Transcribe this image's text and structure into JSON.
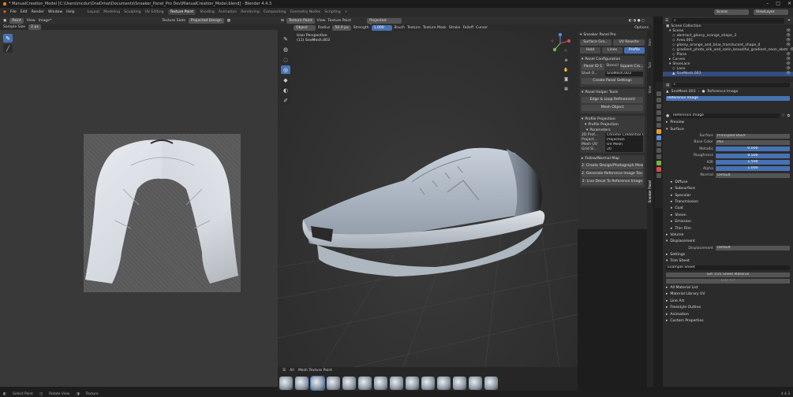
{
  "app": {
    "title": "* ManualCreation_Model [C:\\Users\\mcdur\\OneDrive\\Documents\\Sneaker_Panel_Pro Dev\\ManualCreation_Model.blend] - Blender 4.4.3",
    "logo_color": "#e87d0d",
    "accent": "#4772b3"
  },
  "menu": {
    "items": [
      "File",
      "Edit",
      "Render",
      "Window",
      "Help"
    ],
    "workspaces": [
      "Layout",
      "Modeling",
      "Sculpting",
      "UV Editing",
      "Texture Paint",
      "Shading",
      "Animation",
      "Rendering",
      "Compositing",
      "Geometry Nodes",
      "Scripting"
    ],
    "active_workspace": "Texture Paint",
    "scene_label": "Scene",
    "view_layer_label": "ViewLayer"
  },
  "image_editor": {
    "mode": "Paint",
    "menus": [
      "View",
      "Image*"
    ],
    "slot_label": "Projected Design",
    "tool_label": "Texture Slots",
    "sample": "2 px",
    "tools": [
      "brush-icon",
      "line-icon"
    ]
  },
  "viewport": {
    "mode": "Texture Paint",
    "menus": [
      "View",
      "Texture Paint"
    ],
    "object_mode": "Object",
    "mode_select": "Texture Paint",
    "brush_label": "Brush",
    "radius_label": "Radius",
    "radius_value": "50.0 px",
    "strength_label": "Strength",
    "strength_value": "1.000",
    "texture_label": "Texture",
    "texture_mask": "Texture Mask",
    "stroke": "Stroke",
    "falloff": "Falloff",
    "cursor": "Cursor",
    "options": "Options",
    "view_title": "User Perspective",
    "view_sub": "(11) SneMesh.003",
    "projected_design": "Projected Design",
    "asset_tab": "All",
    "brush_library": "Mesh Texture Paint",
    "brush_count": 14
  },
  "npanel": {
    "header": "Sneaker Panel Pro",
    "surface_btn": "Surface Gro...",
    "uv_btn": "UV Rewrite",
    "row2": [
      "Hold",
      "Lines",
      "Profile"
    ],
    "panel_config": "Panel Configuration",
    "panel_id_label": "Panel ID",
    "panel_id": "Panel ID 1",
    "stencil_label": "Stencil",
    "stencil_val": "Square Cro...",
    "shell_label": "Shell O...",
    "shell_val": "SneMesh.003",
    "create_settings": "Create Panel Settings",
    "helper_tools": "Panel Helper Tools",
    "edge_refine": "Edge & Loop Refinement",
    "mesh_object": "Mesh Object",
    "profile_projection": "Profile Projection",
    "profile_projection2": "Profile Projection",
    "parameters": "Parameters",
    "params": [
      [
        "2D Prof...",
        "Chrome Credential Ref..."
      ],
      [
        "Project...",
        "Projection"
      ],
      [
        "Mesh UV",
        "UV Mesh"
      ],
      [
        "Grid Si...",
        "20"
      ]
    ],
    "follow": "Follow/Normal Map",
    "follow_rows": [
      "2. Create Design/Photograph Mesh...",
      "2. Generate Reference Image Tex...",
      "2. Live Decal To Reference Image"
    ]
  },
  "outliner": {
    "header": "Scene Collection",
    "rows": [
      "Scene",
      "abstract_glossy_orange_shape_3",
      "Area.001",
      "glossy_orange_and_blue_translucent_shape_4",
      "gradient_photo_silk_and_satin_beautiful_gradient_neon_abstr",
      "Plane",
      "Curves",
      "ShoeLace",
      "Lace",
      "SneMesh.003"
    ]
  },
  "properties": {
    "object": "SneMesh.003",
    "material": "Reference Image",
    "slot": "Reference Image",
    "material_name": "Reference Image",
    "preview": "Preview",
    "surface": "Surface",
    "surface_val": "Principled BSDF",
    "base_color_label": "Base Color",
    "base_color_val": "Mix",
    "metallic_label": "Metallic",
    "metallic_val": "0.000",
    "roughness_label": "Roughness",
    "roughness_val": "0.500",
    "ior_label": "IOR",
    "ior_val": "1.500",
    "alpha_label": "Alpha",
    "alpha_val": "1.000",
    "normal_label": "Normal",
    "normal_val": "Default",
    "sections": [
      "Diffuse",
      "Subsurface",
      "Specular",
      "Transmission",
      "Coat",
      "Sheen",
      "Emission",
      "Thin Film"
    ],
    "volume": "Volume",
    "displacement": "Displacement",
    "displacement_label": "Displacement",
    "displacement_val": "Default",
    "settings": "Settings",
    "trim_sheet": "Trim Sheet",
    "trim_val": "Example Sheet",
    "trim_btn": "Set Trim Sheet Material",
    "line_art": "Line Art",
    "custom": [
      "All Material List",
      "Material Library UV",
      "Line Art",
      "Freestyle Outline",
      "Animation",
      "Custom Properties"
    ]
  },
  "status": {
    "items": [
      "Select Paint",
      "Rotate View",
      "Texture"
    ],
    "version": "4.4.3"
  }
}
